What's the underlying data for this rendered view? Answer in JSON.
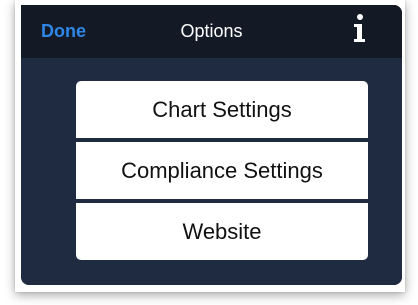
{
  "navbar": {
    "done_label": "Done",
    "title": "Options",
    "info_icon": "info-icon"
  },
  "menu": {
    "items": [
      {
        "label": "Chart Settings"
      },
      {
        "label": "Compliance Settings"
      },
      {
        "label": "Website"
      }
    ]
  },
  "colors": {
    "accent": "#2e86e6",
    "navbar_bg": "#141a25",
    "panel_bg": "#1f2b41",
    "button_bg": "#ffffff"
  }
}
